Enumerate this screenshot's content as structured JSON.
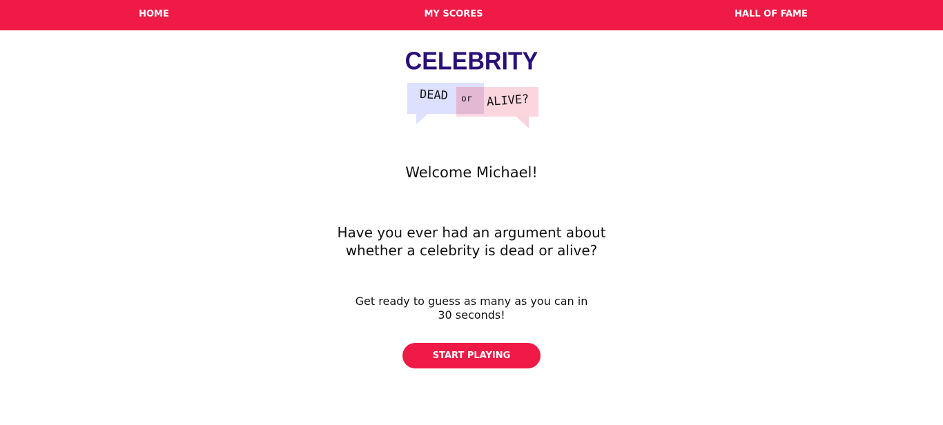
{
  "nav": {
    "home": "HOME",
    "my_scores": "MY SCORES",
    "hall_of_fame": "HALL OF FAME"
  },
  "logo": {
    "title": "CELEBRITY",
    "word_dead": "DEAD",
    "word_or": "or",
    "word_alive": "ALIVE?"
  },
  "main": {
    "welcome": "Welcome Michael!",
    "question": "Have you ever had an argument about whether a celebrity is dead or alive?",
    "instructions": "Get ready to guess as many as you can in 30 seconds!",
    "start_button": "START PLAYING"
  },
  "colors": {
    "accent": "#ef1a45",
    "logo_title": "#2b0f78",
    "bubble_left": "#dde0ff",
    "bubble_right": "#fbd3dc"
  }
}
